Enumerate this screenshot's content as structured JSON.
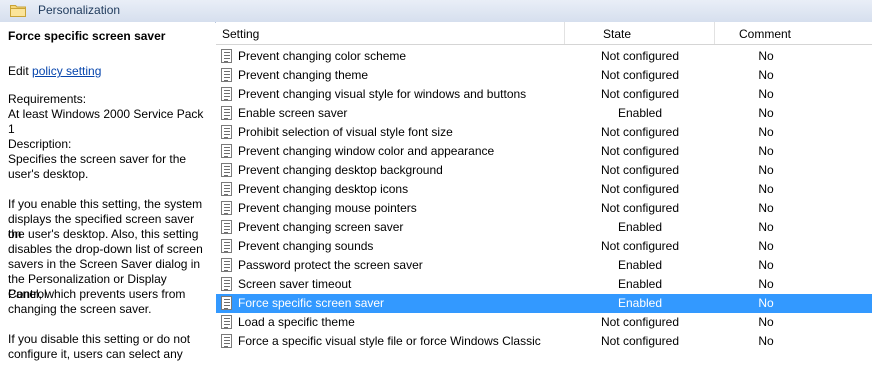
{
  "header": {
    "title": "Personalization"
  },
  "left": {
    "policy_title": "Force specific screen saver",
    "edit_prefix": "Edit ",
    "edit_link": "policy setting",
    "requirements_label": "Requirements:",
    "requirements_value": "At least Windows 2000 Service Pack 1",
    "description_label": "Description:",
    "description_lines": [
      "Specifies the screen saver for the",
      "user's desktop.",
      "",
      "If you enable this setting, the system",
      "displays the specified screen saver on",
      "the user's desktop. Also, this setting",
      "disables the drop-down list of screen",
      "savers in the Screen Saver dialog in",
      "the Personalization or Display Control",
      "Panel, which prevents users from",
      "changing the screen saver.",
      "",
      "If you disable this setting or do not",
      "configure it, users can select any"
    ]
  },
  "table": {
    "columns": {
      "setting": "Setting",
      "state": "State",
      "comment": "Comment"
    },
    "selected_index": 13,
    "rows": [
      {
        "setting": "Prevent changing color scheme",
        "state": "Not configured",
        "comment": "No"
      },
      {
        "setting": "Prevent changing theme",
        "state": "Not configured",
        "comment": "No"
      },
      {
        "setting": "Prevent changing visual style for windows and buttons",
        "state": "Not configured",
        "comment": "No"
      },
      {
        "setting": "Enable screen saver",
        "state": "Enabled",
        "comment": "No"
      },
      {
        "setting": "Prohibit selection of visual style font size",
        "state": "Not configured",
        "comment": "No"
      },
      {
        "setting": "Prevent changing window color and appearance",
        "state": "Not configured",
        "comment": "No"
      },
      {
        "setting": "Prevent changing desktop background",
        "state": "Not configured",
        "comment": "No"
      },
      {
        "setting": "Prevent changing desktop icons",
        "state": "Not configured",
        "comment": "No"
      },
      {
        "setting": "Prevent changing mouse pointers",
        "state": "Not configured",
        "comment": "No"
      },
      {
        "setting": "Prevent changing screen saver",
        "state": "Enabled",
        "comment": "No"
      },
      {
        "setting": "Prevent changing sounds",
        "state": "Not configured",
        "comment": "No"
      },
      {
        "setting": "Password protect the screen saver",
        "state": "Enabled",
        "comment": "No"
      },
      {
        "setting": "Screen saver timeout",
        "state": "Enabled",
        "comment": "No"
      },
      {
        "setting": "Force specific screen saver",
        "state": "Enabled",
        "comment": "No"
      },
      {
        "setting": "Load a specific theme",
        "state": "Not configured",
        "comment": "No"
      },
      {
        "setting": "Force a specific visual style file or force Windows Classic",
        "state": "Not configured",
        "comment": "No"
      }
    ]
  }
}
